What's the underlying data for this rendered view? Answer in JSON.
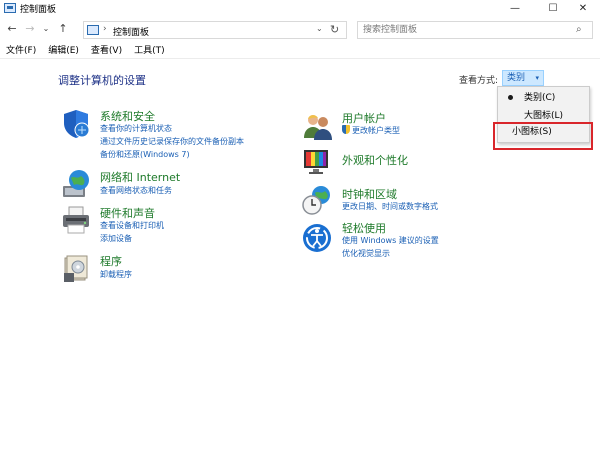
{
  "window": {
    "title": "控制面板",
    "minimize": "—",
    "maximize": "☐",
    "close": "✕"
  },
  "nav": {
    "back": "←",
    "forward": "→",
    "recent": "⌄",
    "up": "↑"
  },
  "address": {
    "separator": "›",
    "crumb": "控制面板",
    "dropdown": "⌄",
    "refresh": "↻"
  },
  "search": {
    "placeholder": "搜索控制面板",
    "icon": "⌕"
  },
  "menubar": [
    "文件(F)",
    "编辑(E)",
    "查看(V)",
    "工具(T)"
  ],
  "main": {
    "title": "调整计算机的设置",
    "viewby_label": "查看方式:",
    "viewby_value": "类别",
    "viewby_arrow": "▾"
  },
  "categories": [
    {
      "title": "系统和安全",
      "icon": "shield-icon",
      "links": [
        "查看你的计算机状态",
        "通过文件历史记录保存你的文件备份副本",
        "备份和还原(Windows 7)"
      ]
    },
    {
      "title": "网络和 Internet",
      "icon": "globe-network-icon",
      "links": [
        "查看网络状态和任务"
      ]
    },
    {
      "title": "硬件和声音",
      "icon": "printer-icon",
      "links": [
        "查看设备和打印机",
        "添加设备"
      ]
    },
    {
      "title": "程序",
      "icon": "programs-icon",
      "links": [
        "卸载程序"
      ]
    },
    {
      "title": "用户帐户",
      "icon": "users-icon",
      "links": [
        "更改帐户类型"
      ]
    },
    {
      "title": "外观和个性化",
      "icon": "monitor-icon",
      "links": []
    },
    {
      "title": "时钟和区域",
      "icon": "clock-globe-icon",
      "links": [
        "更改日期、时间或数字格式"
      ]
    },
    {
      "title": "轻松使用",
      "icon": "accessibility-icon",
      "links": [
        "使用 Windows 建议的设置",
        "优化视觉显示"
      ]
    }
  ],
  "dropdown": {
    "items": [
      "类别(C)",
      "大图标(L)",
      "小图标(S)"
    ],
    "selected": "类别(C)"
  },
  "colors": {
    "title_blue": "#1e3287",
    "category_green": "#1e7a2a",
    "link_blue": "#1a5fb4",
    "highlight_red": "#d9262b"
  }
}
